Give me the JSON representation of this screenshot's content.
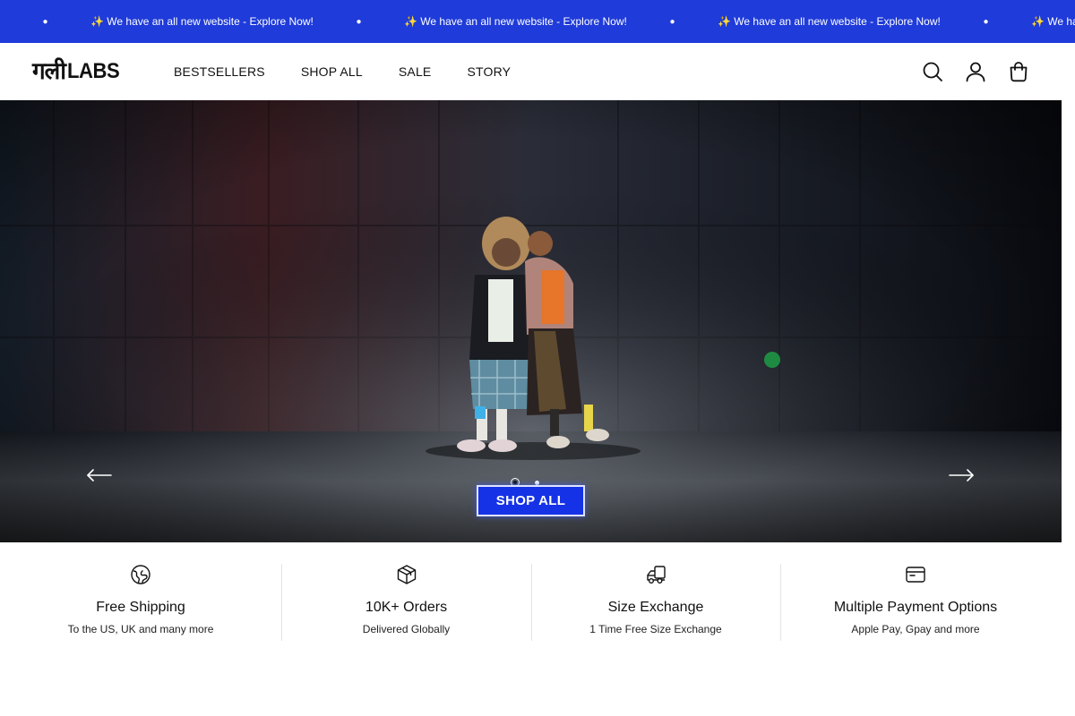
{
  "announcement": {
    "message": "✨ We have an all new website - Explore Now!",
    "separator": "●",
    "background": "#1f3bd9"
  },
  "header": {
    "logo": {
      "devanagari": "गली",
      "latin": "LABS"
    },
    "nav": [
      {
        "label": "BESTSELLERS"
      },
      {
        "label": "SHOP ALL"
      },
      {
        "label": "SALE"
      },
      {
        "label": "STORY"
      }
    ],
    "icons": [
      "search-icon",
      "account-icon",
      "cart-icon"
    ]
  },
  "hero": {
    "cta_label": "SHOP ALL",
    "cta_color": "#1632e6",
    "slides_total": 2,
    "active_slide": 1,
    "prev_icon": "arrow-left-icon",
    "next_icon": "arrow-right-icon"
  },
  "features": [
    {
      "icon": "globe-icon",
      "title": "Free Shipping",
      "subtitle": "To the US, UK and many more"
    },
    {
      "icon": "box-icon",
      "title": "10K+ Orders",
      "subtitle": "Delivered Globally"
    },
    {
      "icon": "truck-icon",
      "title": "Size Exchange",
      "subtitle": "1 Time Free Size Exchange"
    },
    {
      "icon": "card-icon",
      "title": "Multiple Payment Options",
      "subtitle": "Apple Pay, Gpay and more"
    }
  ]
}
